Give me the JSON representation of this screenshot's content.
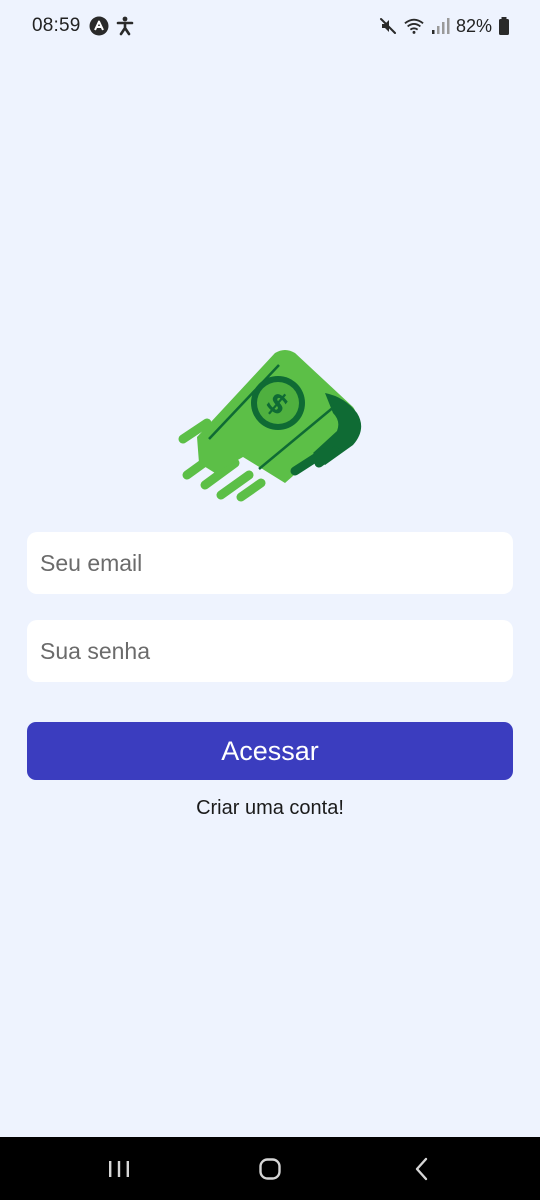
{
  "status_bar": {
    "time": "08:59",
    "battery": "82%"
  },
  "form": {
    "email_placeholder": "Seu email",
    "password_placeholder": "Sua senha",
    "submit_label": "Acessar",
    "create_account_label": "Criar uma conta!"
  },
  "colors": {
    "background": "#eef3fe",
    "primary": "#3b3dbf",
    "logo_green_light": "#5cbf47",
    "logo_green_dark": "#0f6b34"
  },
  "icons": {
    "logo": "flying-money-icon",
    "status_left": [
      "app-a-icon",
      "accessibility-icon"
    ],
    "status_right": [
      "mute-icon",
      "wifi-icon",
      "signal-icon",
      "battery-icon"
    ],
    "nav": [
      "recent-apps-icon",
      "home-icon",
      "back-icon"
    ]
  }
}
